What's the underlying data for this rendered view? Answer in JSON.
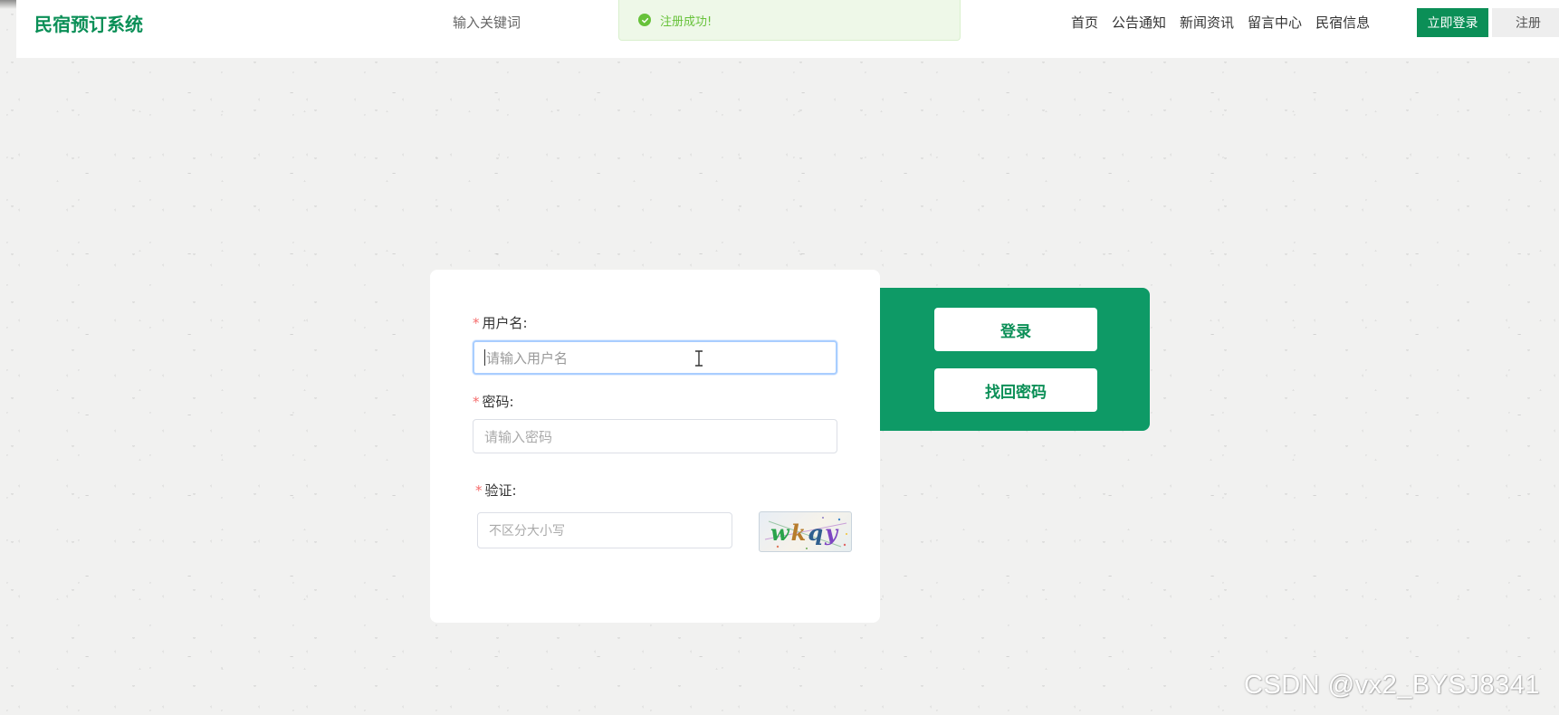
{
  "header": {
    "logo": "民宿预订系统",
    "search_placeholder": "输入关键词",
    "nav": [
      "首页",
      "公告通知",
      "新闻资讯",
      "留言中心",
      "民宿信息"
    ],
    "login_button": "立即登录",
    "register_button": "注册"
  },
  "toast": {
    "message": "注册成功!",
    "icon": "check-circle-icon",
    "color": "#67c23a"
  },
  "login_form": {
    "username": {
      "label": "用户名:",
      "placeholder": "请输入用户名",
      "required": true
    },
    "password": {
      "label": "密码:",
      "placeholder": "请输入密码",
      "required": true
    },
    "captcha": {
      "label": "验证:",
      "placeholder": "不区分大小写",
      "code": [
        "w",
        "k",
        "q",
        "y"
      ],
      "required": true
    }
  },
  "actions": {
    "login": "登录",
    "recover_password": "找回密码"
  },
  "colors": {
    "brand": "#0b8f57",
    "panel": "#0e9a66",
    "required_star": "#f56c6c"
  },
  "watermark": "CSDN @vx2_BYSJ8341"
}
